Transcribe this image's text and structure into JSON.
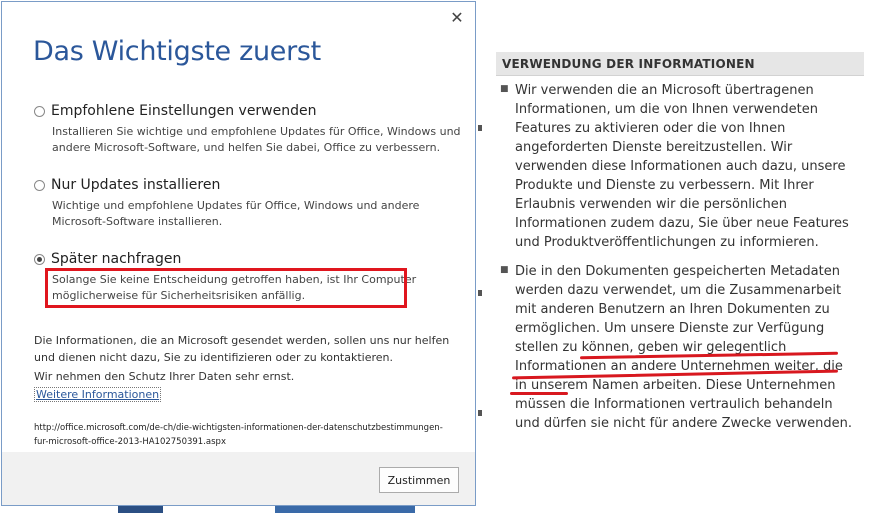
{
  "dialog": {
    "title": "Das Wichtigste zuerst",
    "close_glyph": "✕",
    "options": [
      {
        "label": "Empfohlene Einstellungen verwenden",
        "description": "Installieren Sie wichtige und empfohlene Updates für Office, Windows und andere Microsoft-Software, und helfen Sie dabei, Office zu verbessern.",
        "selected": false
      },
      {
        "label": "Nur Updates installieren",
        "description": "Wichtige und empfohlene Updates für Office, Windows und andere Microsoft-Software installieren.",
        "selected": false
      },
      {
        "label": "Später nachfragen",
        "description": "Solange Sie keine Entscheidung getroffen haben, ist Ihr Computer möglicherweise für Sicherheitsrisiken anfällig.",
        "selected": true
      }
    ],
    "info_text_1": "Die Informationen, die an Microsoft gesendet werden, sollen uns nur helfen und dienen nicht dazu, Sie zu identifizieren oder zu kontaktieren.",
    "info_text_2": "Wir nehmen den Schutz Ihrer Daten sehr ernst.",
    "more_info_link": "Weitere Informationen",
    "url": "http://office.microsoft.com/de-ch/die-wichtigsten-informationen-der-datenschutzbestimmungen-fur-microsoft-office-2013-HA102750391.aspx",
    "agree_button": "Zustimmen"
  },
  "panel": {
    "header": "VERWENDUNG DER INFORMATIONEN",
    "bullet_glyph": "■",
    "bullets": [
      "Wir verwenden die an Microsoft übertragenen Informationen, um die von Ihnen verwendeten Features zu aktivieren oder die von Ihnen angeforderten Dienste bereitzustellen. Wir verwenden diese Informationen auch dazu, unsere Produkte und Dienste zu verbessern. Mit Ihrer Erlaubnis verwenden wir die persönlichen Informationen zudem dazu, Sie über neue Features und Produktveröffentlichungen zu informieren.",
      "Die in den Dokumenten gespeicherten Metadaten werden dazu verwendet, um die Zusammenarbeit mit anderen Benutzern an Ihren Dokumenten zu ermöglichen. Um unsere Dienste zur Verfügung stellen zu können, geben wir gelegentlich Informationen an andere Unternehmen weiter, die in unserem Namen arbeiten. Diese Unternehmen müssen die Informationen vertraulich behandeln und dürfen sie nicht für andere Zwecke verwenden."
    ]
  },
  "colors": {
    "title_blue": "#2b579a",
    "highlight_red": "#e0161e",
    "panel_header_bg": "#e6e6e6"
  }
}
